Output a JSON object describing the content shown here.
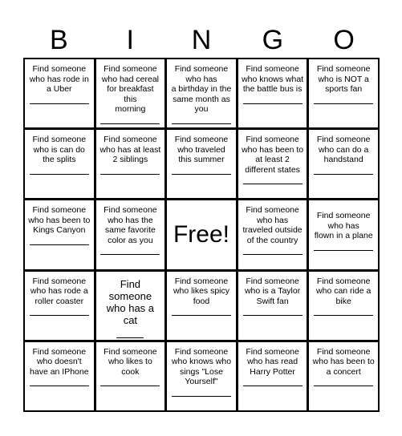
{
  "header": {
    "letters": [
      "B",
      "I",
      "N",
      "G",
      "O"
    ]
  },
  "board": {
    "line_placeholder": "______________",
    "rows": [
      [
        {
          "text": "Find someone\nwho has rode in\na Uber",
          "type": "normal"
        },
        {
          "text": "Find someone\nwho had cereal\nfor breakfast this\nmorning",
          "type": "normal"
        },
        {
          "text": "Find someone\nwho has\na birthday in the\nsame month as\nyou",
          "type": "normal"
        },
        {
          "text": "Find someone\nwho knows what\nthe battle bus is",
          "type": "normal"
        },
        {
          "text": "Find someone\nwho is NOT a\nsports fan",
          "type": "normal"
        }
      ],
      [
        {
          "text": "Find someone\nwho is can do\nthe splits",
          "type": "normal"
        },
        {
          "text": "Find someone\nwho has at least\n2 siblings",
          "type": "normal"
        },
        {
          "text": "Find someone\nwho traveled\nthis summer",
          "type": "normal"
        },
        {
          "text": "Find someone\nwho has been to\nat least 2\ndifferent states",
          "type": "normal"
        },
        {
          "text": "Find someone\nwho can do a\nhandstand",
          "type": "normal"
        }
      ],
      [
        {
          "text": "Find someone\nwho has been to\nKings Canyon",
          "type": "normal"
        },
        {
          "text": "Find someone\nwho has the\nsame favorite\ncolor as you",
          "type": "normal"
        },
        {
          "text": "Free!",
          "type": "free"
        },
        {
          "text": "Find someone\nwho has\ntraveled outside\nof the country",
          "type": "normal"
        },
        {
          "text": "Find someone\nwho has\nflown in a plane",
          "type": "centered"
        }
      ],
      [
        {
          "text": "Find someone\nwho has rode a\nroller coaster",
          "type": "normal"
        },
        {
          "text": "Find\nsomeone\nwho has a\ncat",
          "type": "large"
        },
        {
          "text": "Find someone\nwho likes spicy\nfood",
          "type": "normal"
        },
        {
          "text": "Find someone\nwho is a Taylor\nSwift fan",
          "type": "normal"
        },
        {
          "text": "Find someone\nwho can ride a\nbike",
          "type": "normal"
        }
      ],
      [
        {
          "text": "Find someone\nwho doesn't\nhave an IPhone",
          "type": "normal"
        },
        {
          "text": "Find someone\nwho likes to\ncook",
          "type": "normal"
        },
        {
          "text": "Find someone\nwho knows who\nsings \"Lose\nYourself\"",
          "type": "normal"
        },
        {
          "text": "Find someone\nwho has read\nHarry Potter",
          "type": "normal"
        },
        {
          "text": "Find someone\nwho has been to\na concert",
          "type": "normal"
        }
      ]
    ]
  }
}
